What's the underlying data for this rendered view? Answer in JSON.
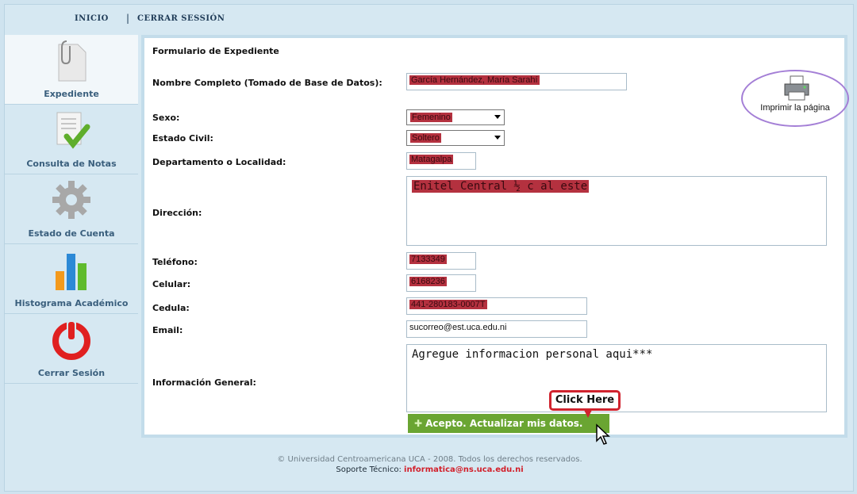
{
  "topnav": {
    "inicio": "INICIO",
    "separator": "|",
    "cerrar": "CERRAR SESSIÓN"
  },
  "sidebar": {
    "items": [
      {
        "label": "Expediente",
        "icon": "document-clip-icon"
      },
      {
        "label": "Consulta de Notas",
        "icon": "checklist-icon"
      },
      {
        "label": "Estado de Cuenta",
        "icon": "gear-icon"
      },
      {
        "label": "Histograma Académico",
        "icon": "bar-chart-icon"
      },
      {
        "label": "Cerrar Sesión",
        "icon": "power-icon"
      }
    ]
  },
  "form": {
    "title": "Formulario de Expediente",
    "labels": {
      "nombre": "Nombre Completo (Tomado de Base de Datos):",
      "sexo": "Sexo:",
      "estado_civil": "Estado Civil:",
      "departamento": "Departamento o Localidad:",
      "direccion": "Dirección:",
      "telefono": "Teléfono:",
      "celular": "Celular:",
      "cedula": "Cedula:",
      "email": "Email:",
      "info_general": "Información General:"
    },
    "values": {
      "nombre": "García Hernández, María Sarahí",
      "sexo": "Femenino",
      "estado_civil": "Soltero",
      "departamento": "Matagalpa",
      "direccion": "Enitel Central ½ c al este",
      "telefono": "7133349",
      "celular": "6168236",
      "cedula": "441-280183-0007T",
      "email": "sucorreo@est.uca.edu.ni",
      "info_general": "Agregue informacion personal aqui***"
    },
    "submit_label": "Acepto. Actualizar mis datos."
  },
  "print": {
    "label": "Imprimir la página"
  },
  "callout": {
    "label": "Click Here"
  },
  "footer": {
    "copyright": "© Universidad Centroamericana UCA - 2008. Todos los derechos reservados.",
    "support_label": "Soporte Técnico:",
    "support_email": "informatica@ns.uca.edu.ni"
  },
  "colors": {
    "accent_green": "#6aa532",
    "redaction": "#b4313f",
    "callout_red": "#d0232e",
    "print_ring": "#a47fd6"
  }
}
